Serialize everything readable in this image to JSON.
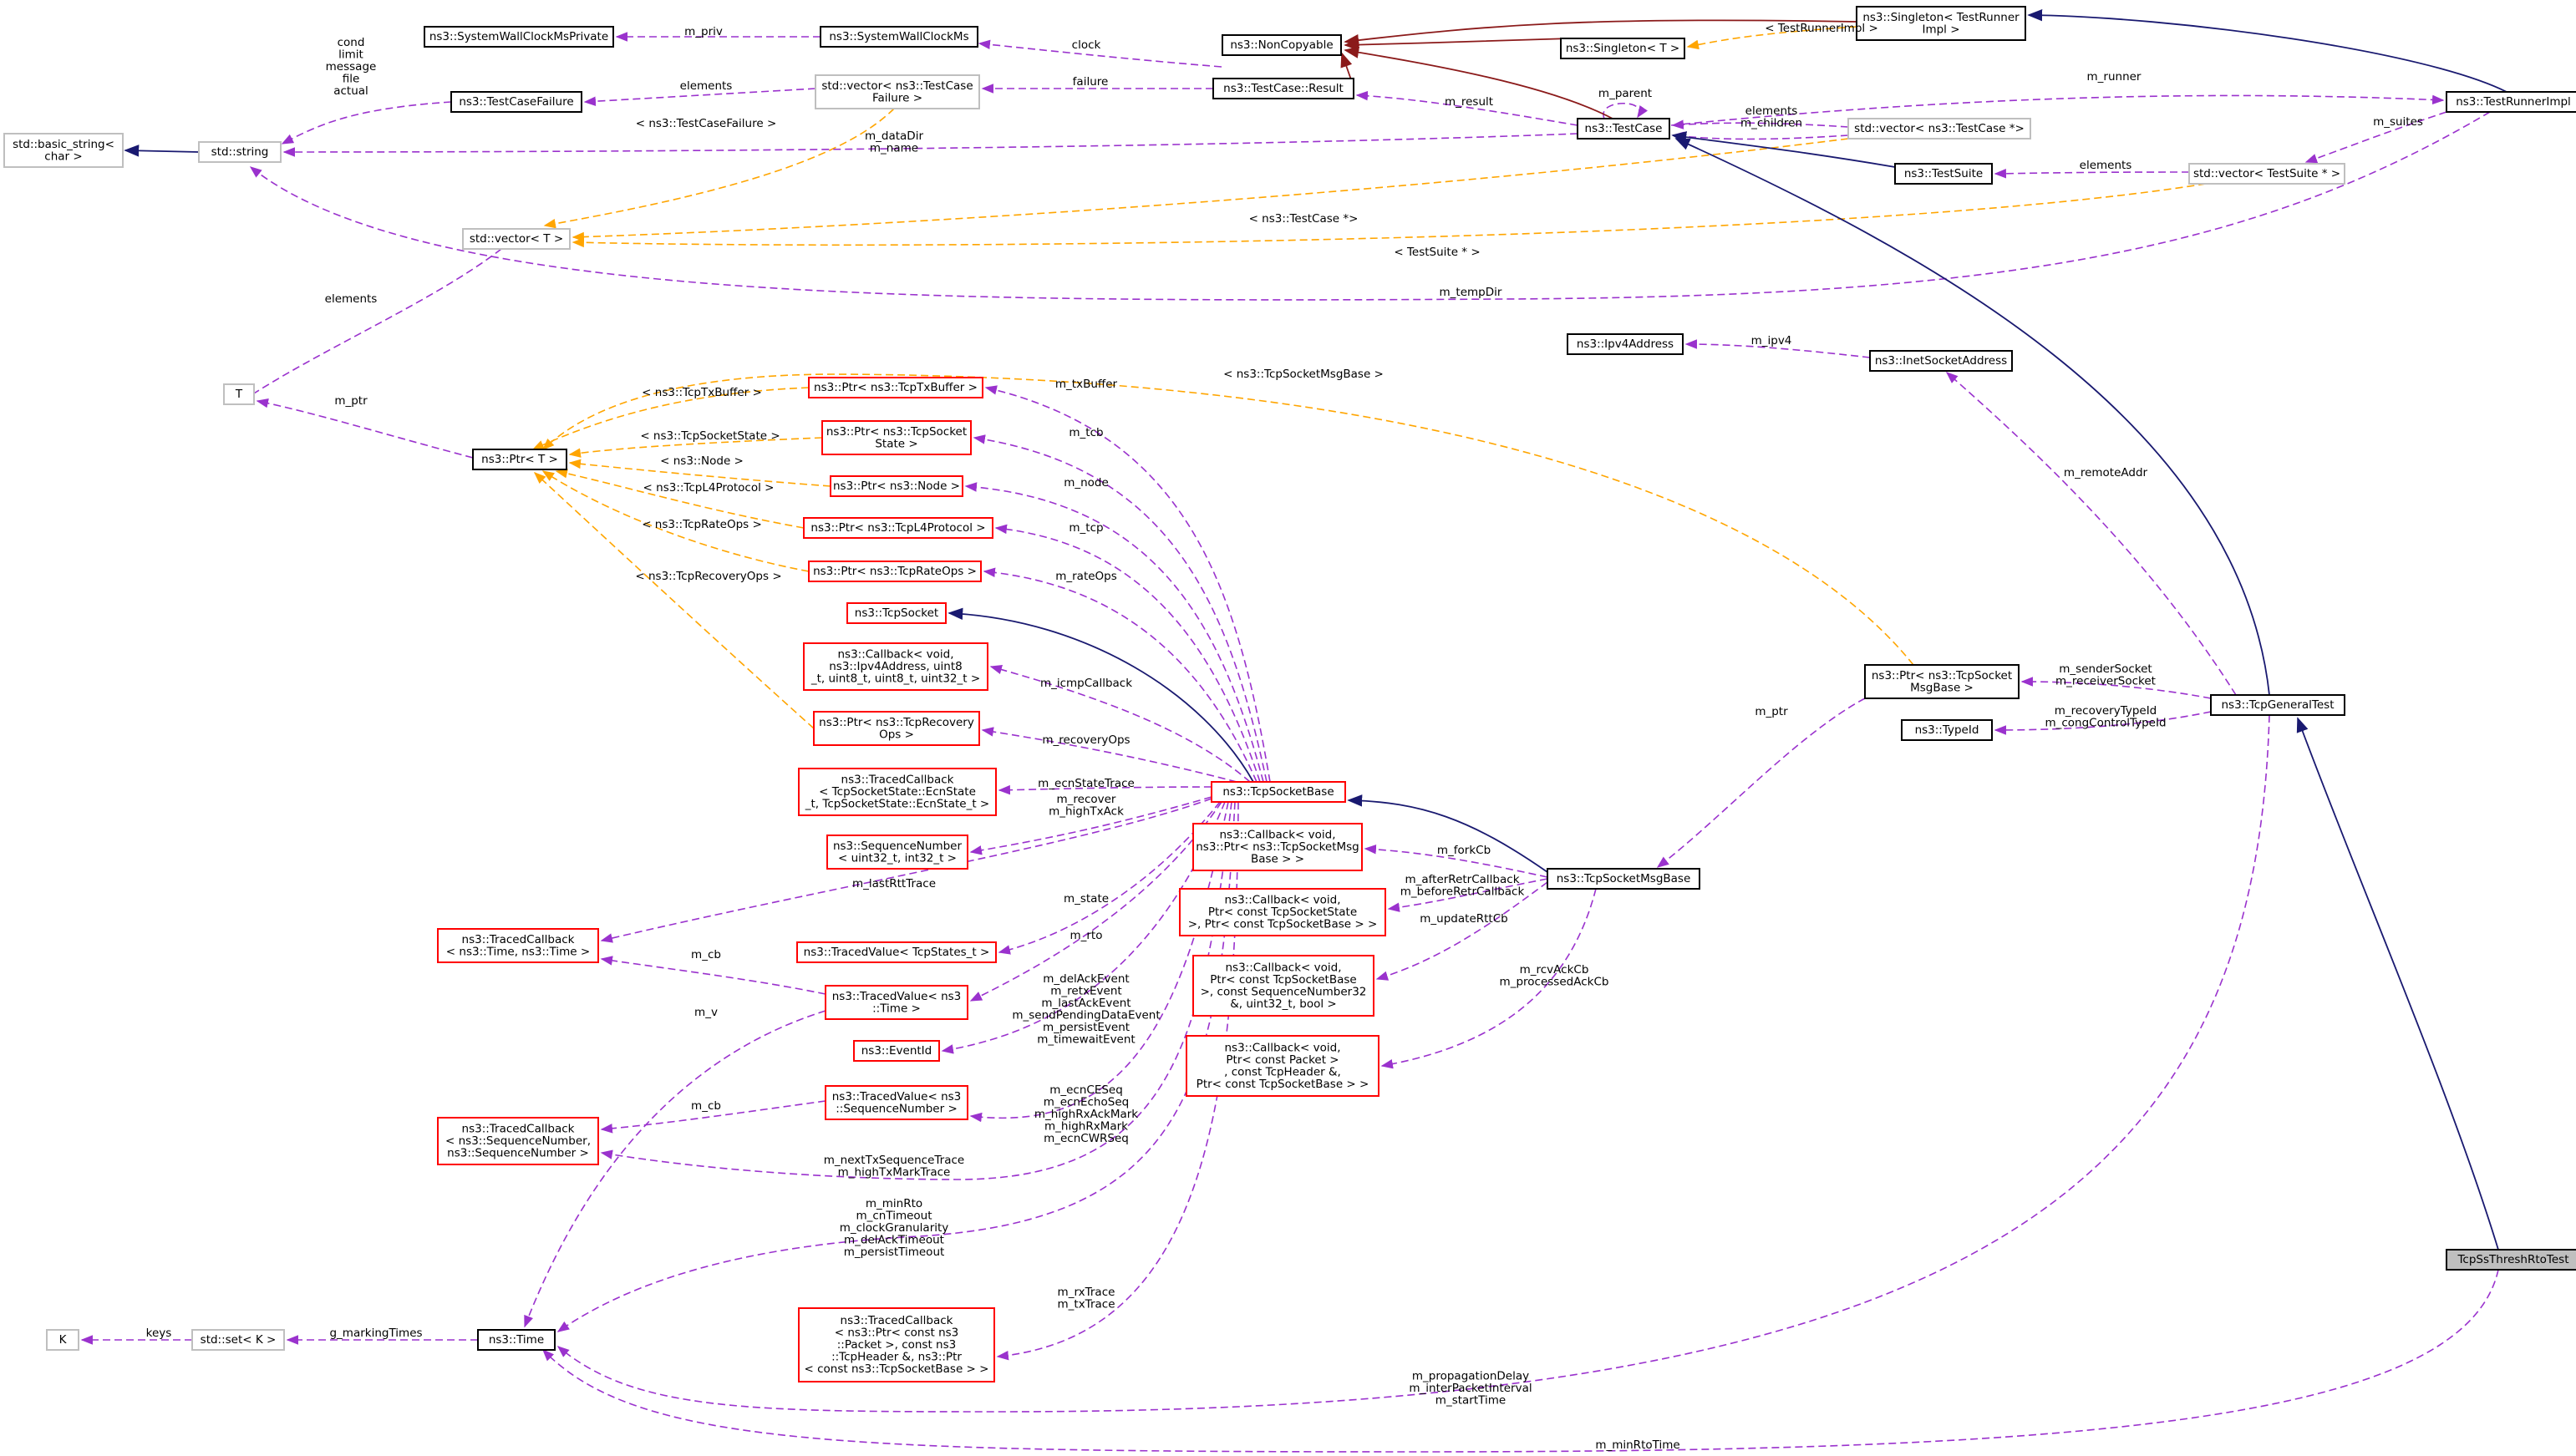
{
  "diagram": {
    "nodes": [
      {
        "id": "swcmp",
        "label": [
          "ns3::SystemWallClockMsPrivate"
        ],
        "style": "black"
      },
      {
        "id": "swcm",
        "label": [
          "ns3::SystemWallClockMs"
        ],
        "style": "black"
      },
      {
        "id": "noncopy",
        "label": [
          "ns3::NonCopyable"
        ],
        "style": "black"
      },
      {
        "id": "singT",
        "label": [
          "ns3::Singleton< T >"
        ],
        "style": "black"
      },
      {
        "id": "singTR",
        "label": [
          "ns3::Singleton< TestRunner",
          "Impl >"
        ],
        "style": "black"
      },
      {
        "id": "tri",
        "label": [
          "ns3::TestRunnerImpl"
        ],
        "style": "black"
      },
      {
        "id": "bstr",
        "label": [
          "std::basic_string<",
          "char >"
        ],
        "style": "gray"
      },
      {
        "id": "str",
        "label": [
          "std::string"
        ],
        "style": "gray"
      },
      {
        "id": "tcf",
        "label": [
          "ns3::TestCaseFailure"
        ],
        "style": "black"
      },
      {
        "id": "vtcf",
        "label": [
          "std::vector< ns3::TestCase",
          "Failure >"
        ],
        "style": "gray"
      },
      {
        "id": "result",
        "label": [
          "ns3::TestCase::Result"
        ],
        "style": "black"
      },
      {
        "id": "tc",
        "label": [
          "ns3::TestCase"
        ],
        "style": "black"
      },
      {
        "id": "vtc",
        "label": [
          "std::vector< ns3::TestCase *>"
        ],
        "style": "gray"
      },
      {
        "id": "ts",
        "label": [
          "ns3::TestSuite"
        ],
        "style": "black"
      },
      {
        "id": "vts",
        "label": [
          "std::vector< TestSuite * >"
        ],
        "style": "gray"
      },
      {
        "id": "vT",
        "label": [
          "std::vector< T >"
        ],
        "style": "gray"
      },
      {
        "id": "T",
        "label": [
          "T"
        ],
        "style": "gray"
      },
      {
        "id": "ptrT",
        "label": [
          "ns3::Ptr< T >"
        ],
        "style": "black"
      },
      {
        "id": "ptxb",
        "label": [
          "ns3::Ptr< ns3::TcpTxBuffer >"
        ],
        "style": "red"
      },
      {
        "id": "ptss",
        "label": [
          "ns3::Ptr< ns3::TcpSocket",
          "State >"
        ],
        "style": "red"
      },
      {
        "id": "pnode",
        "label": [
          "ns3::Ptr< ns3::Node >"
        ],
        "style": "red"
      },
      {
        "id": "pl4",
        "label": [
          "ns3::Ptr< ns3::TcpL4Protocol >"
        ],
        "style": "red"
      },
      {
        "id": "prate",
        "label": [
          "ns3::Ptr< ns3::TcpRateOps >"
        ],
        "style": "red"
      },
      {
        "id": "tsock",
        "label": [
          "ns3::TcpSocket"
        ],
        "style": "red"
      },
      {
        "id": "cbicmp",
        "label": [
          "ns3::Callback< void,",
          "ns3::Ipv4Address, uint8",
          "_t, uint8_t, uint8_t, uint32_t >"
        ],
        "style": "red"
      },
      {
        "id": "precov",
        "label": [
          "ns3::Ptr< ns3::TcpRecovery",
          "Ops >"
        ],
        "style": "red"
      },
      {
        "id": "tcecn",
        "label": [
          "ns3::TracedCallback",
          "< TcpSocketState::EcnState",
          "_t, TcpSocketState::EcnState_t >"
        ],
        "style": "red"
      },
      {
        "id": "seqn",
        "label": [
          "ns3::SequenceNumber",
          "< uint32_t, int32_t >"
        ],
        "style": "red"
      },
      {
        "id": "tctime",
        "label": [
          "ns3::TracedCallback",
          "< ns3::Time, ns3::Time >"
        ],
        "style": "red"
      },
      {
        "id": "tvstate",
        "label": [
          "ns3::TracedValue< TcpStates_t >"
        ],
        "style": "red"
      },
      {
        "id": "tvtime",
        "label": [
          "ns3::TracedValue< ns3",
          "::Time >"
        ],
        "style": "red"
      },
      {
        "id": "evid",
        "label": [
          "ns3::EventId"
        ],
        "style": "red"
      },
      {
        "id": "tvseq",
        "label": [
          "ns3::TracedValue< ns3",
          "::SequenceNumber >"
        ],
        "style": "red"
      },
      {
        "id": "tcseq",
        "label": [
          "ns3::TracedCallback",
          "< ns3::SequenceNumber,",
          "ns3::SequenceNumber >"
        ],
        "style": "red"
      },
      {
        "id": "K",
        "label": [
          "K"
        ],
        "style": "gray"
      },
      {
        "id": "setK",
        "label": [
          "std::set< K >"
        ],
        "style": "gray"
      },
      {
        "id": "time",
        "label": [
          "ns3::Time"
        ],
        "style": "black"
      },
      {
        "id": "tcrx",
        "label": [
          "ns3::TracedCallback",
          "< ns3::Ptr< const ns3",
          "::Packet >, const ns3",
          "::TcpHeader &, ns3::Ptr",
          "< const ns3::TcpSocketBase > >"
        ],
        "style": "red"
      },
      {
        "id": "tsb",
        "label": [
          "ns3::TcpSocketBase"
        ],
        "style": "red"
      },
      {
        "id": "cbfork",
        "label": [
          "ns3::Callback< void,",
          "ns3::Ptr< ns3::TcpSocketMsg",
          "Base > >"
        ],
        "style": "red"
      },
      {
        "id": "cbretr",
        "label": [
          "ns3::Callback< void,",
          "Ptr< const TcpSocketState",
          ">, Ptr< const TcpSocketBase > >"
        ],
        "style": "red"
      },
      {
        "id": "cbrtt",
        "label": [
          "ns3::Callback< void,",
          "Ptr< const TcpSocketBase",
          ">, const SequenceNumber32",
          "&, uint32_t, bool >"
        ],
        "style": "red"
      },
      {
        "id": "cbrcv",
        "label": [
          "ns3::Callback< void,",
          "Ptr< const Packet >",
          ", const TcpHeader &,",
          "Ptr< const TcpSocketBase > >"
        ],
        "style": "red"
      },
      {
        "id": "ipv4",
        "label": [
          "ns3::Ipv4Address"
        ],
        "style": "black"
      },
      {
        "id": "inet",
        "label": [
          "ns3::InetSocketAddress"
        ],
        "style": "black"
      },
      {
        "id": "pmsg",
        "label": [
          "ns3::Ptr< ns3::TcpSocket",
          "MsgBase >"
        ],
        "style": "black"
      },
      {
        "id": "typeid",
        "label": [
          "ns3::TypeId"
        ],
        "style": "black"
      },
      {
        "id": "tgt",
        "label": [
          "ns3::TcpGeneralTest"
        ],
        "style": "black"
      },
      {
        "id": "tsmb",
        "label": [
          "ns3::TcpSocketMsgBase"
        ],
        "style": "black"
      },
      {
        "id": "rto",
        "label": [
          "TcpSsThreshRtoTest"
        ],
        "style": "fill"
      }
    ],
    "edge_labels": {
      "m_priv": [
        "m_priv"
      ],
      "clock": [
        "clock"
      ],
      "elements_tcf": [
        "elements"
      ],
      "failure": [
        "failure"
      ],
      "tcf_tmpl": [
        "< ns3::TestCaseFailure >"
      ],
      "str_fields": [
        "cond",
        "limit",
        "message",
        "file",
        "actual"
      ],
      "datadir": [
        "m_dataDir",
        "m_name"
      ],
      "m_result": [
        "m_result"
      ],
      "m_parent": [
        "m_parent"
      ],
      "children": [
        "elements",
        "m_children"
      ],
      "tc_tmpl": [
        "< ns3::TestCase *>"
      ],
      "m_runner": [
        "m_runner"
      ],
      "singtr_tmpl": [
        "< TestRunnerImpl >"
      ],
      "m_suites": [
        "m_suites"
      ],
      "elements_ts": [
        "elements"
      ],
      "ts_tmpl": [
        "< TestSuite * >"
      ],
      "m_tempDir": [
        "m_tempDir"
      ],
      "elements_vT": [
        "elements"
      ],
      "m_ptr_T": [
        "m_ptr"
      ],
      "t_txb": [
        "< ns3::TcpTxBuffer >"
      ],
      "t_ss": [
        "< ns3::TcpSocketState >"
      ],
      "t_node": [
        "< ns3::Node >"
      ],
      "t_l4": [
        "< ns3::TcpL4Protocol >"
      ],
      "t_rate": [
        "< ns3::TcpRateOps >"
      ],
      "t_recov": [
        "< ns3::TcpRecoveryOps >"
      ],
      "t_msg": [
        "< ns3::TcpSocketMsgBase >"
      ],
      "m_txBuffer": [
        "m_txBuffer"
      ],
      "m_tcb": [
        "m_tcb"
      ],
      "m_node": [
        "m_node"
      ],
      "m_tcp": [
        "m_tcp"
      ],
      "m_rateOps": [
        "m_rateOps"
      ],
      "m_icmp": [
        "m_icmpCallback"
      ],
      "m_recoveryOps": [
        "m_recoveryOps"
      ],
      "m_ecnState": [
        "m_ecnStateTrace"
      ],
      "m_recover": [
        "m_recover",
        "m_highTxAck"
      ],
      "m_lastRtt": [
        "m_lastRttTrace"
      ],
      "m_state": [
        "m_state"
      ],
      "m_rto": [
        "m_rto"
      ],
      "m_cb_time": [
        "m_cb"
      ],
      "m_v": [
        "m_v"
      ],
      "events": [
        "m_delAckEvent",
        "m_retxEvent",
        "m_lastAckEvent",
        "m_sendPendingDataEvent",
        "m_persistEvent",
        "m_timewaitEvent"
      ],
      "ecnseq": [
        "m_ecnCESeq",
        "m_ecnEchoSeq",
        "m_highRxAckMark",
        "m_highRxMark",
        "m_ecnCWRSeq"
      ],
      "m_cb_seq": [
        "m_cb"
      ],
      "nexttx": [
        "m_nextTxSequenceTrace",
        "m_highTxMarkTrace"
      ],
      "timers": [
        "m_minRto",
        "m_cnTimeout",
        "m_clockGranularity",
        "m_delAckTimeout",
        "m_persistTimeout"
      ],
      "rxtx": [
        "m_rxTrace",
        "m_txTrace"
      ],
      "keys": [
        "keys"
      ],
      "markingtimes": [
        "g_markingTimes"
      ],
      "m_forkCb": [
        "m_forkCb"
      ],
      "retrcb": [
        "m_afterRetrCallback",
        "m_beforeRetrCallback"
      ],
      "m_updateRtt": [
        "m_updateRttCb"
      ],
      "rcvack": [
        "m_rcvAckCb",
        "m_processedAckCb"
      ],
      "m_ipv4": [
        "m_ipv4"
      ],
      "m_remoteAddr": [
        "m_remoteAddr"
      ],
      "m_ptr_msg": [
        "m_ptr"
      ],
      "sockets": [
        "m_senderSocket",
        "m_receiverSocket"
      ],
      "typeids": [
        "m_recoveryTypeId",
        "m_congControlTypeId"
      ],
      "propdelay": [
        "m_propagationDelay",
        "m_interPacketInterval",
        "m_startTime"
      ],
      "minrto": [
        "m_minRtoTime"
      ]
    }
  }
}
